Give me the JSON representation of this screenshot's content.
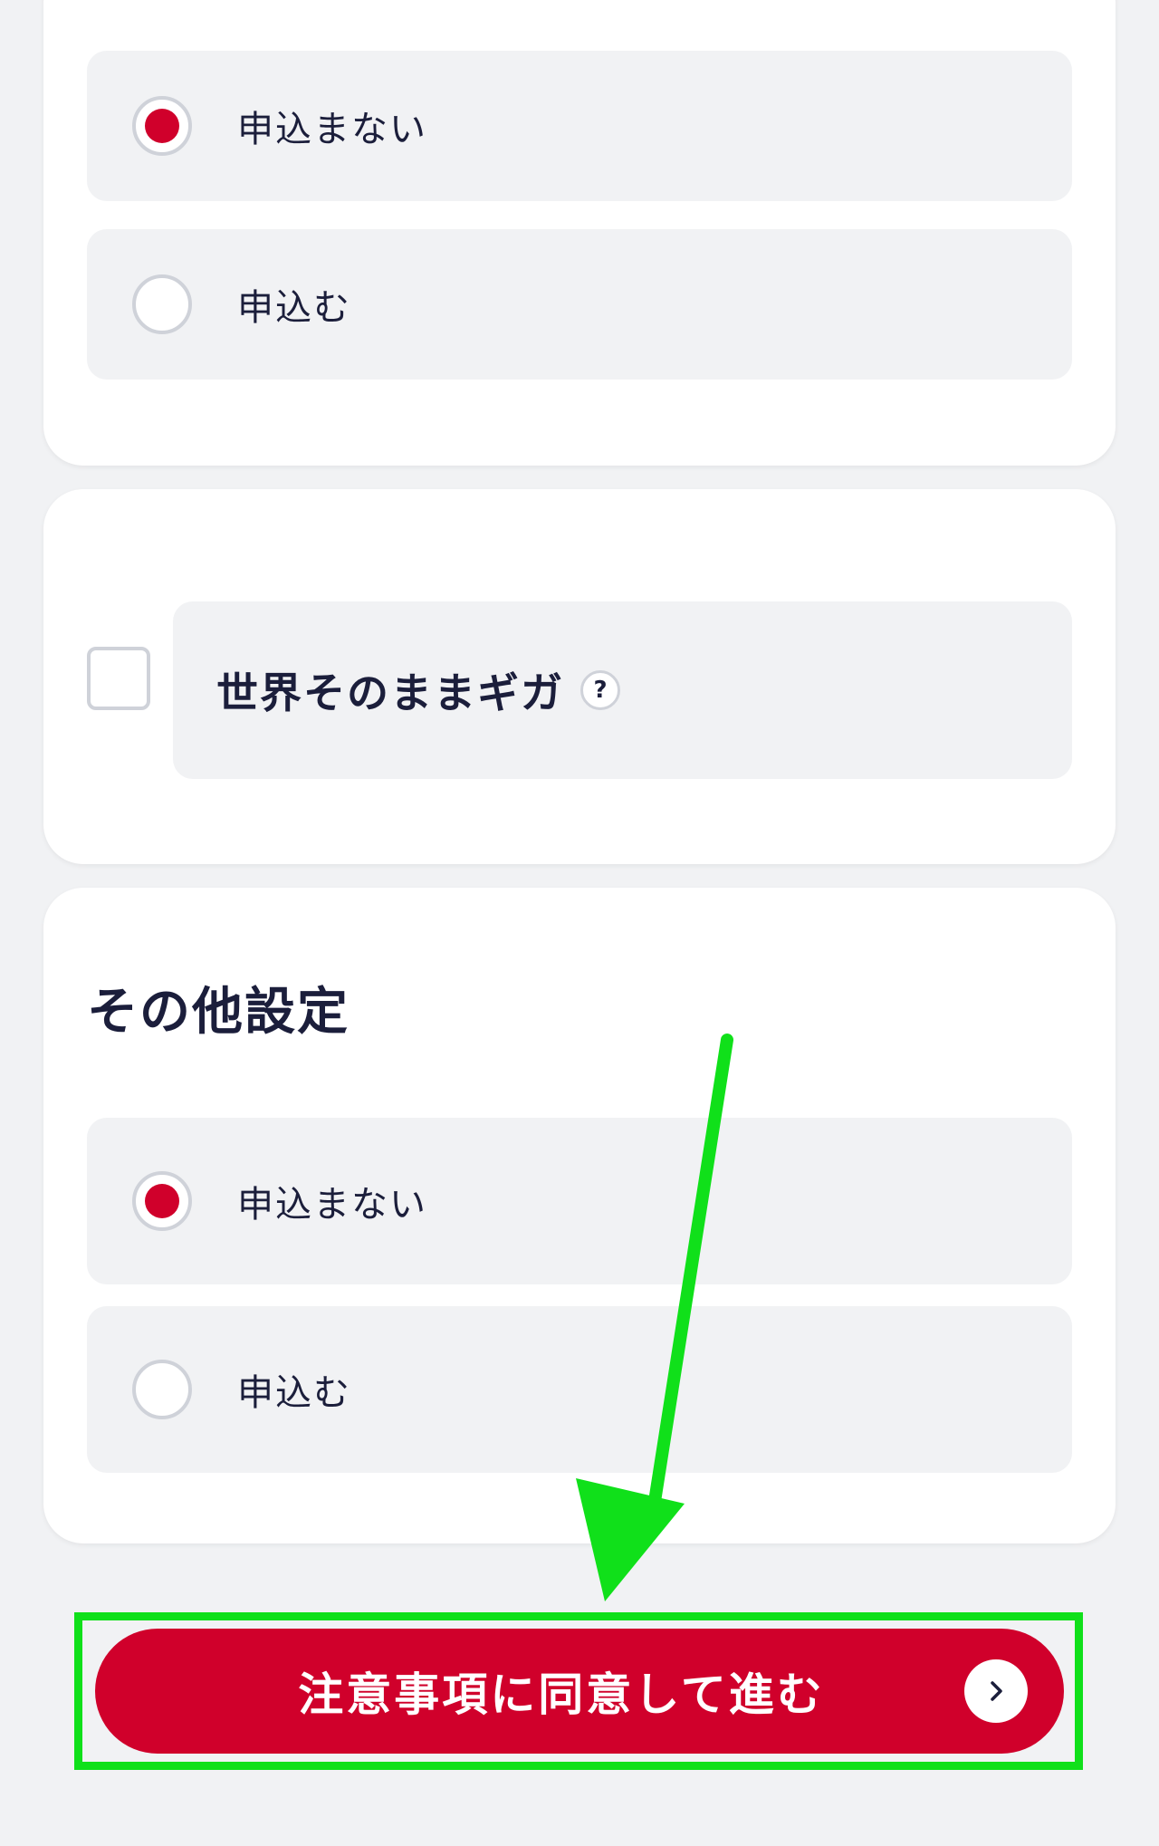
{
  "section1": {
    "options": [
      {
        "label": "申込まない",
        "selected": true
      },
      {
        "label": "申込む",
        "selected": false
      }
    ]
  },
  "section2": {
    "checkbox_label": "世界そのままギガ",
    "help_glyph": "?",
    "checked": false
  },
  "section3": {
    "title": "その他設定",
    "options": [
      {
        "label": "申込まない",
        "selected": true
      },
      {
        "label": "申込む",
        "selected": false
      }
    ]
  },
  "cta": {
    "label": "注意事項に同意して進む",
    "icon": "chevron-right-icon"
  },
  "colors": {
    "accent": "#d0002b",
    "highlight": "#10e01a",
    "background": "#f1f2f4",
    "text": "#1b1e3b"
  }
}
